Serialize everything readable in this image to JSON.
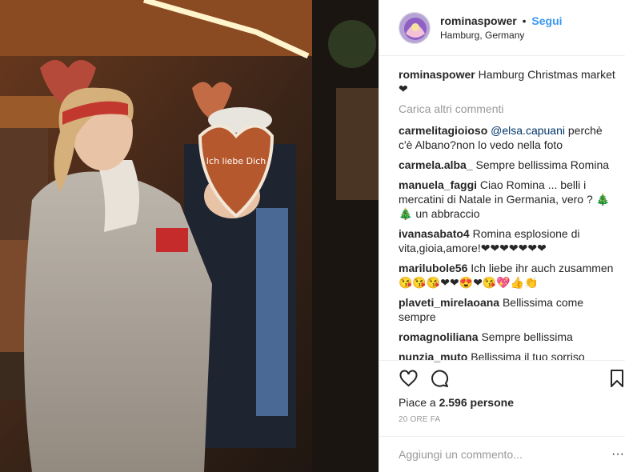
{
  "post": {
    "author": "rominaspower",
    "separator": "•",
    "follow_label": "Segui",
    "location": "Hamburg, Germany",
    "caption": "Hamburg Christmas market ❤",
    "load_more": "Carica altri commenti",
    "likes_label": "Piace a",
    "likes_count": "2.596 persone",
    "time_ago": "20 ORE FA",
    "comment_placeholder": "Aggiungi un commento...",
    "more_glyph": "···"
  },
  "comments": [
    {
      "user": "carmelitagioioso",
      "mention": "@elsa.capuani",
      "text": " perchè c'è Albano?non lo vedo nella foto"
    },
    {
      "user": "carmela.alba_",
      "mention": "",
      "text": "Sempre bellissima Romina"
    },
    {
      "user": "manuela_faggi",
      "mention": "",
      "text": "Ciao Romina ... belli i mercatini di Natale in Germania, vero ? 🎄 🎄 un abbraccio"
    },
    {
      "user": "ivanasabato4",
      "mention": "",
      "text": "Romina esplosione di vita,gioia,amore!❤❤❤❤❤❤❤"
    },
    {
      "user": "marilubole56",
      "mention": "",
      "text": "Ich liebe ihr auch zusammen 😘😘😘❤❤😍❤😘💖👍👏"
    },
    {
      "user": "plaveti_mirelaoana",
      "mention": "",
      "text": "Bellissima come sempre"
    },
    {
      "user": "romagnoliliana",
      "mention": "",
      "text": "Sempre bellissima"
    },
    {
      "user": "nunzia_muto",
      "mention": "",
      "text": "Bellissima il tuo sorriso"
    }
  ],
  "photo": {
    "cookie_text": "Ich liebe Dich"
  },
  "icons": {
    "like": "heart-icon",
    "comment": "speech-bubble-icon",
    "save": "bookmark-icon"
  },
  "colors": {
    "follow": "#3897f0",
    "muted": "#999999",
    "text": "#262626"
  }
}
